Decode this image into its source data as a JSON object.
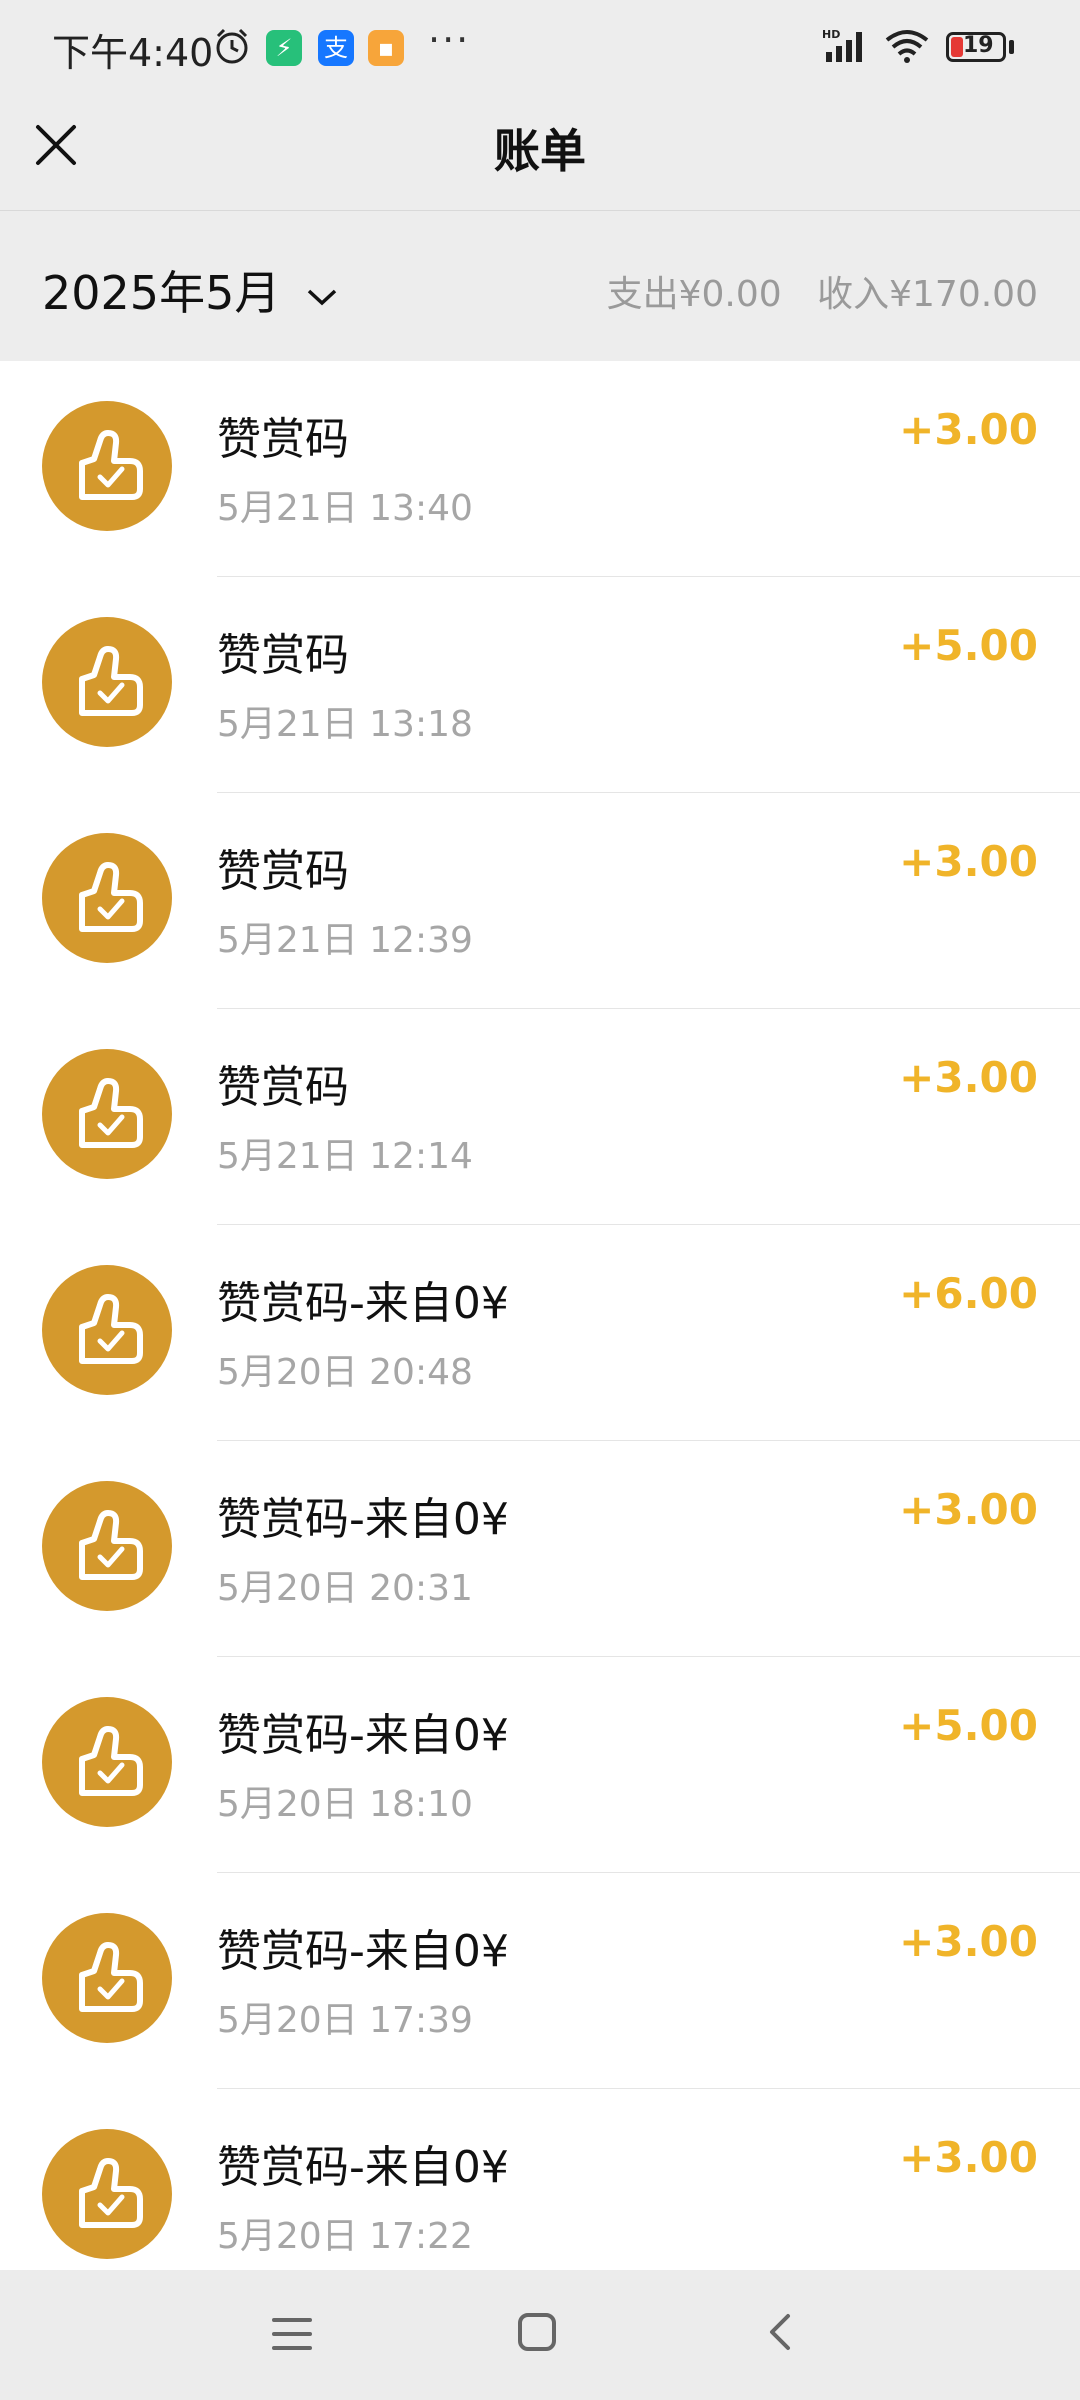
{
  "status_bar": {
    "time": "下午4:40",
    "battery_level": "19",
    "icons": [
      "alarm-icon",
      "app-badge-icon",
      "alipay-icon",
      "app-badge-icon",
      "more-icon",
      "signal-icon",
      "wifi-icon",
      "battery-icon"
    ]
  },
  "title_bar": {
    "title": "账单"
  },
  "month_bar": {
    "month": "2025年5月",
    "expense": "支出¥0.00",
    "income": "收入¥170.00"
  },
  "transactions": [
    {
      "title": "赞赏码",
      "time": "5月21日 13:40",
      "amount": "+3.00"
    },
    {
      "title": "赞赏码",
      "time": "5月21日 13:18",
      "amount": "+5.00"
    },
    {
      "title": "赞赏码",
      "time": "5月21日 12:39",
      "amount": "+3.00"
    },
    {
      "title": "赞赏码",
      "time": "5月21日 12:14",
      "amount": "+3.00"
    },
    {
      "title": "赞赏码-来自0¥",
      "time": "5月20日 20:48",
      "amount": "+6.00"
    },
    {
      "title": "赞赏码-来自0¥",
      "time": "5月20日 20:31",
      "amount": "+3.00"
    },
    {
      "title": "赞赏码-来自0¥",
      "time": "5月20日 18:10",
      "amount": "+5.00"
    },
    {
      "title": "赞赏码-来自0¥",
      "time": "5月20日 17:39",
      "amount": "+3.00"
    },
    {
      "title": "赞赏码-来自0¥",
      "time": "5月20日 17:22",
      "amount": "+3.00"
    }
  ],
  "colors": {
    "accent_amount": "#f0b429",
    "avatar_bg": "#d4992d",
    "background": "#ededed"
  }
}
